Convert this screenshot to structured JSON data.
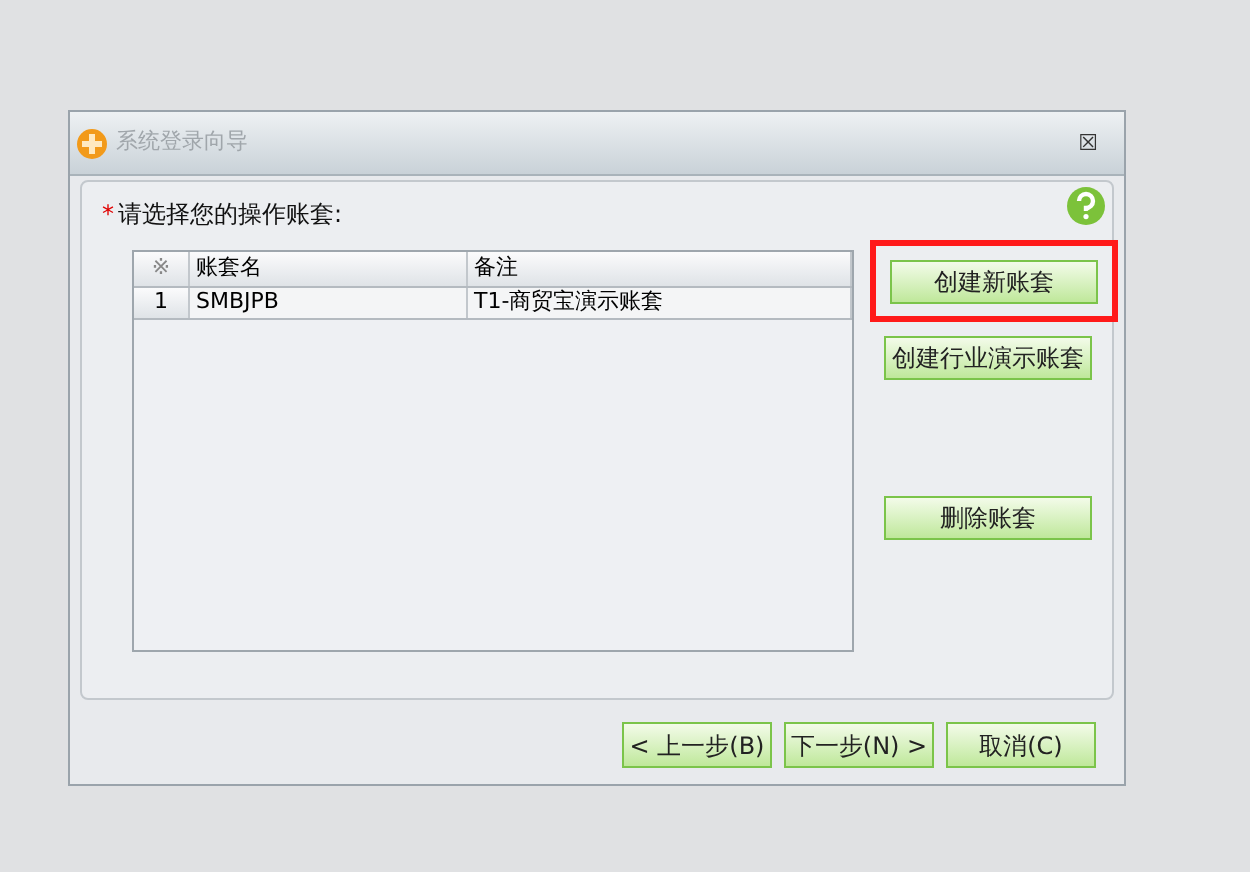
{
  "window": {
    "title": "系统登录向导",
    "close": "☒"
  },
  "prompt": {
    "required": "*",
    "text": "请选择您的操作账套:"
  },
  "table": {
    "columns": [
      "※",
      "账套名",
      "备注"
    ],
    "rows": [
      {
        "cells": [
          "1",
          "SMBJPB",
          "T1-商贸宝演示账套"
        ],
        "selected": false
      }
    ]
  },
  "side_buttons": [
    {
      "label": "创建新账套",
      "highlighted": true
    },
    {
      "label": "创建行业演示账套",
      "highlighted": false
    },
    {
      "label": "删除账套",
      "highlighted": false
    }
  ],
  "nav_buttons": [
    "< 上一步(B)",
    "下一步(N) >",
    "取消(C)"
  ]
}
